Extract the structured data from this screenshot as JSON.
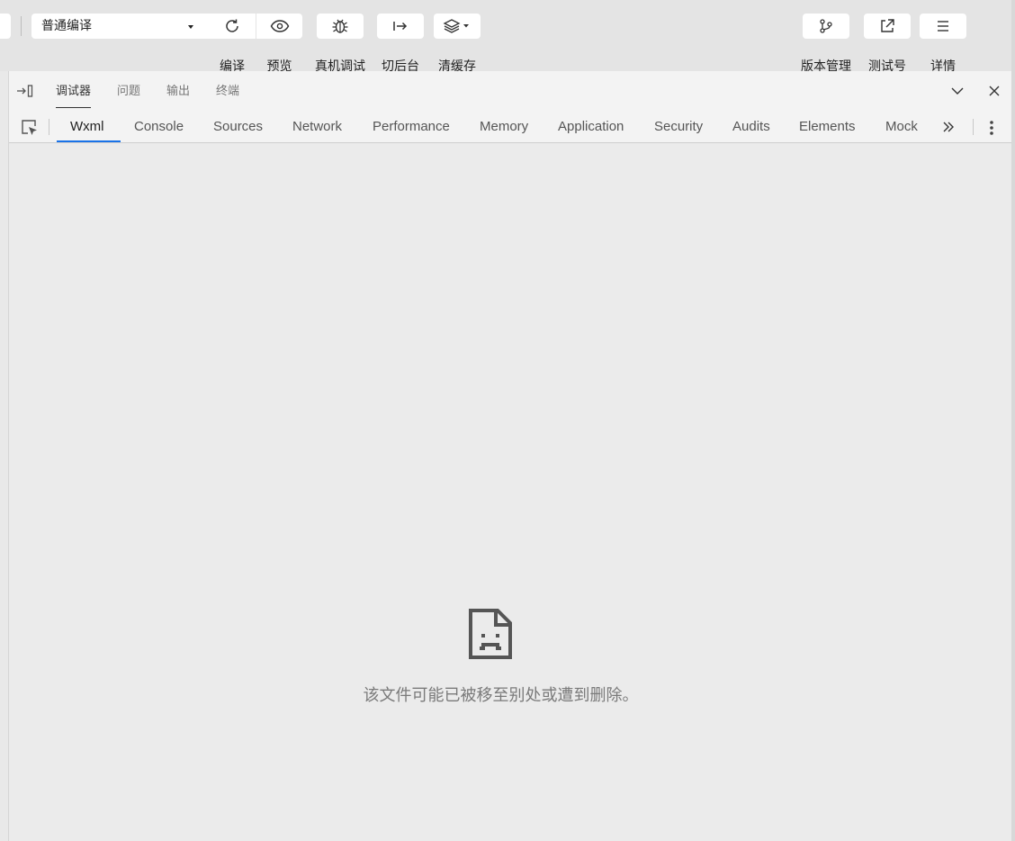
{
  "toolbar": {
    "compile_mode": {
      "selected": "普通编译"
    },
    "buttons": [
      {
        "id": "compile",
        "label": "编译",
        "icon": "refresh-icon"
      },
      {
        "id": "preview",
        "label": "预览",
        "icon": "eye-icon"
      },
      {
        "id": "remote-debug",
        "label": "真机调试",
        "icon": "bug-icon"
      },
      {
        "id": "background",
        "label": "切后台",
        "icon": "switch-background-icon"
      },
      {
        "id": "clear-cache",
        "label": "清缓存",
        "icon": "layers-icon"
      },
      {
        "id": "version",
        "label": "版本管理",
        "icon": "branch-icon"
      },
      {
        "id": "test-account",
        "label": "测试号",
        "icon": "external-link-icon"
      },
      {
        "id": "details",
        "label": "详情",
        "icon": "menu-icon"
      }
    ]
  },
  "panel_tabs": [
    {
      "label": "调试器",
      "active": true
    },
    {
      "label": "问题",
      "active": false
    },
    {
      "label": "输出",
      "active": false
    },
    {
      "label": "终端",
      "active": false
    }
  ],
  "devtools_tabs": [
    {
      "label": "Wxml",
      "active": true
    },
    {
      "label": "Console",
      "active": false
    },
    {
      "label": "Sources",
      "active": false
    },
    {
      "label": "Network",
      "active": false
    },
    {
      "label": "Performance",
      "active": false
    },
    {
      "label": "Memory",
      "active": false
    },
    {
      "label": "Application",
      "active": false
    },
    {
      "label": "Security",
      "active": false
    },
    {
      "label": "Audits",
      "active": false
    },
    {
      "label": "Elements",
      "active": false
    },
    {
      "label": "Mock",
      "active": false
    }
  ],
  "empty_state": {
    "icon": "sad-file-icon",
    "message": "该文件可能已被移至别处或遭到删除。"
  },
  "colors": {
    "accent": "#1a73e8",
    "background": "#e9e9e9",
    "toolbar": "#e4e4e4",
    "tab_bar": "#f3f3f3"
  }
}
